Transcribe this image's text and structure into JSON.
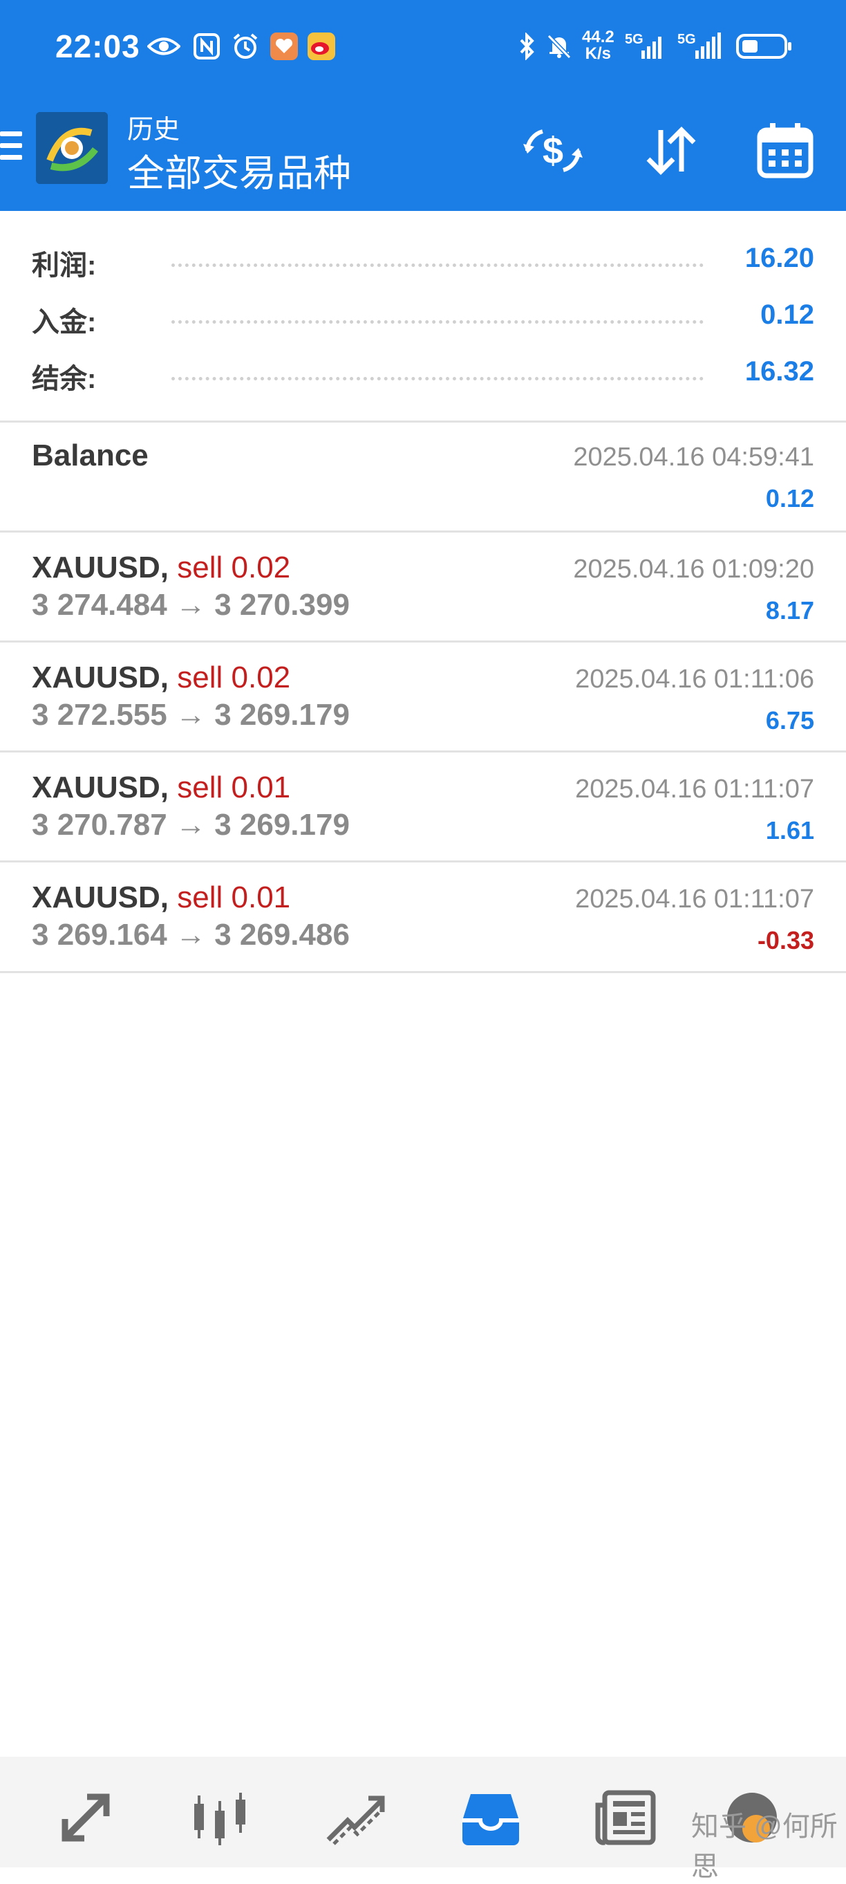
{
  "status_bar": {
    "time": "22:03",
    "net_speed_value": "44.2",
    "net_speed_unit": "K/s",
    "signal_1": "5G",
    "signal_2": "5G"
  },
  "app_bar": {
    "subtitle": "历史",
    "title": "全部交易品种",
    "icons": [
      "menu-icon",
      "dollar-refresh-icon",
      "sort-icon",
      "calendar-icon"
    ]
  },
  "summary": {
    "profit_label": "利润:",
    "profit_value": "16.20",
    "deposit_label": "入金:",
    "deposit_value": "0.12",
    "balance_label": "结余:",
    "balance_value": "16.32"
  },
  "entries": [
    {
      "symbol": "Balance",
      "direction": "",
      "prices": "",
      "time": "2025.04.16 04:59:41",
      "profit": "0.12"
    },
    {
      "symbol": "XAUUSD,",
      "direction": "sell 0.02",
      "prices": "3 274.484 → 3 270.399",
      "time": "2025.04.16 01:09:20",
      "profit": "8.17"
    },
    {
      "symbol": "XAUUSD,",
      "direction": "sell 0.02",
      "prices": "3 272.555 → 3 269.179",
      "time": "2025.04.16 01:11:06",
      "profit": "6.75"
    },
    {
      "symbol": "XAUUSD,",
      "direction": "sell 0.01",
      "prices": "3 270.787 → 3 269.179",
      "time": "2025.04.16 01:11:07",
      "profit": "1.61"
    },
    {
      "symbol": "XAUUSD,",
      "direction": "sell 0.01",
      "prices": "3 269.164 → 3 269.486",
      "time": "2025.04.16 01:11:07",
      "profit": "-0.33"
    }
  ],
  "bottom_nav": {
    "items": [
      "quotes-icon",
      "chart-icon",
      "trade-icon",
      "history-icon",
      "news-icon",
      "settings-icon"
    ],
    "watermark": "知乎 @何所思"
  },
  "colors": {
    "accent": "#1b7ee6",
    "negative": "#c41f1f",
    "text": "#333333",
    "muted": "#8a8a8a"
  }
}
